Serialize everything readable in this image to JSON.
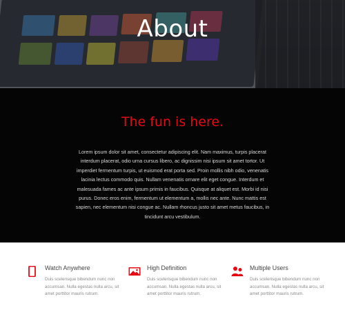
{
  "hero": {
    "title": "About"
  },
  "intro": {
    "tagline": "The fun is here.",
    "body": "Lorem ipsum dolor sit amet, consectetur adipiscing elit. Nam maximus, turpis placerat interdum placerat, odio urna cursus libero, ac dignissim nisi ipsum sit amet tortor. Ut imperdiet fermentum turpis, ut euismod erat porta sed. Proin mollis nibh odio, venenatis lacinia lectus commodo quis. Nullam venenatis ornare elit eget congue. Interdum et malesuada fames ac ante ipsum primis in faucibus. Quisque at aliquet est. Morbi id nisi purus. Donec eros enim, fermentum ut elementum a, mollis nec ante. Nunc mattis est sapien, nec elementum nisi congue ac. Nullam rhoncus justo sit amet metus faucibus, in tincidunt arcu vestibulum."
  },
  "features": [
    {
      "icon": "smartphone-icon",
      "title": "Watch Anywhere",
      "desc": "Duis scelerisque bibendum nunc non accumsan. Nulla egestas nulla arcu, sit amet porttitor mauris rutrum."
    },
    {
      "icon": "image-icon",
      "title": "High Definition",
      "desc": "Duis scelerisque bibendum nunc non accumsan. Nulla egestas nulla arcu, sit amet porttitor mauris rutrum."
    },
    {
      "icon": "users-icon",
      "title": "Multiple Users",
      "desc": "Duis scelerisque bibendum nunc non accumsan. Nulla egestas nulla arcu, sit amet porttitor mauris rutrum."
    }
  ],
  "colors": {
    "accent": "#e50914",
    "dark_bg": "#050505",
    "page_bg": "#ffffff"
  }
}
